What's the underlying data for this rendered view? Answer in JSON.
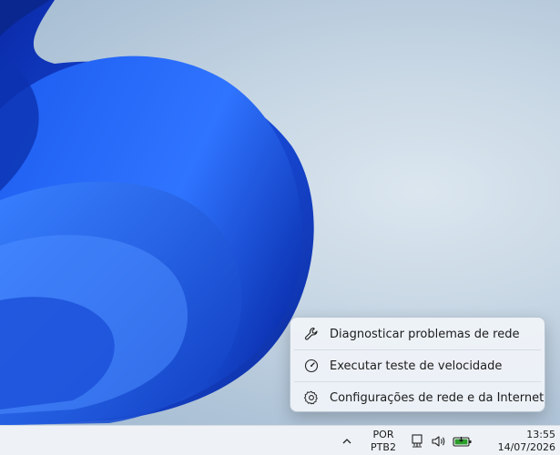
{
  "context_menu": {
    "items": [
      {
        "label": "Diagnosticar problemas de rede",
        "icon": "wrench-icon"
      },
      {
        "label": "Executar teste de velocidade",
        "icon": "speedometer-icon"
      },
      {
        "label": "Configurações de rede e da Internet",
        "icon": "gear-icon"
      }
    ]
  },
  "taskbar": {
    "overflow_icon": "chevron-up-icon",
    "language": {
      "line1": "POR",
      "line2": "PTB2"
    },
    "tray_icons": [
      "network-icon",
      "volume-icon",
      "battery-icon"
    ],
    "clock": {
      "time": "13:55",
      "date": "14/07/2026"
    }
  },
  "colors": {
    "accent_blue": "#1f5fe0",
    "battery_green": "#2a9d2a"
  }
}
